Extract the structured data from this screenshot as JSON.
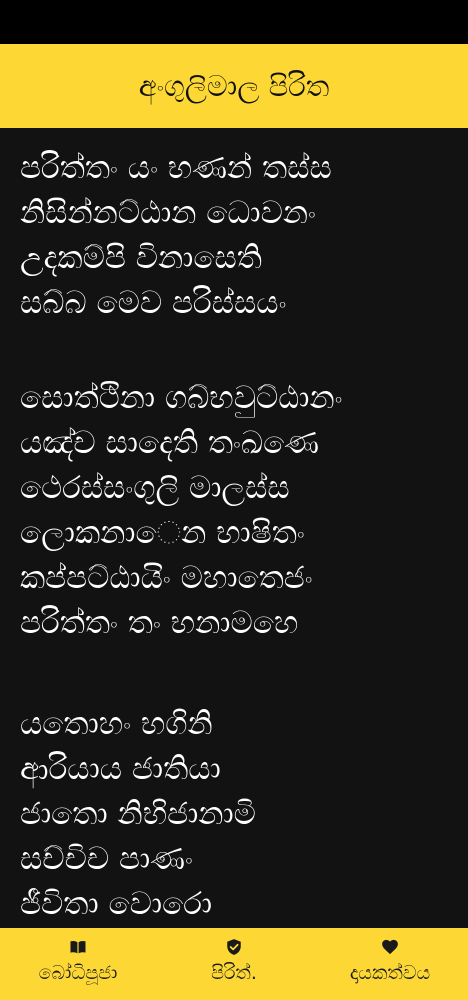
{
  "header": {
    "title": "අංගුලිමාල පිරිත"
  },
  "verses": [
    {
      "lines": [
        "පරිත්තං යං භණන් තස්ස",
        "නිසින්නට්ඨාන ධොවනං",
        "උදකම්පි විනාසෙති",
        "සබ්බ මෙව පරිස්සයං"
      ]
    },
    {
      "lines": [
        "සොත්ථිනා ගබ්භවුට්ඨානං",
        "යඤ්ච සාදෙති තංඛණෙ",
        "ථෙරස්සංගුලි මාලස්ස",
        "ලොකනාෙන භාෂිතං",
        "කප්පට්ඨායිං මහාතෙජං",
        "පරිත්තං තං භනාමහෙ"
      ]
    },
    {
      "lines": [
        "යතොහං භගිනි",
        "ආරියාය ජාතියා",
        "ජාතො නිභිජානාමි",
        "සච්චිච පාණං",
        "ජීවිතා වොරො"
      ]
    }
  ],
  "bottom_nav": {
    "items": [
      {
        "label": "බෝධිපූජා",
        "icon": "book-icon"
      },
      {
        "label": "පිරිත්.",
        "icon": "shield-check-icon"
      },
      {
        "label": "දායකත්වය",
        "icon": "heart-icon"
      }
    ]
  },
  "colors": {
    "accent": "#fdd835",
    "background": "#121212",
    "text": "#ffffff",
    "status_bar": "#000000"
  }
}
